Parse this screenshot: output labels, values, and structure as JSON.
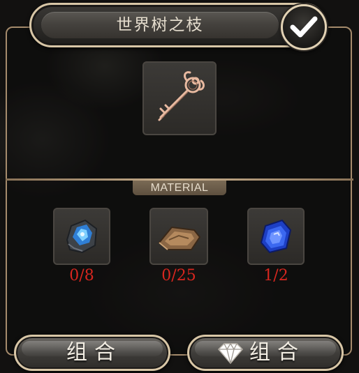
{
  "header": {
    "title": "世界树之枝",
    "confirm_icon": "checkmark-icon"
  },
  "result_item": {
    "icon": "ornate-key-icon"
  },
  "materials": {
    "section_label": "MATERIAL",
    "items": [
      {
        "icon": "blue-gem-ore-icon",
        "count": "0/8"
      },
      {
        "icon": "brown-leather-scrap-icon",
        "count": "0/25"
      },
      {
        "icon": "blue-sapphire-icon",
        "count": "1/2"
      }
    ]
  },
  "actions": {
    "combine_label": "组合",
    "diamond_combine_label": "组合",
    "diamond_icon": "diamond-icon"
  },
  "colors": {
    "frame": "#a58b6c",
    "count_text": "#d7261f",
    "title_text": "#e4dccd"
  }
}
